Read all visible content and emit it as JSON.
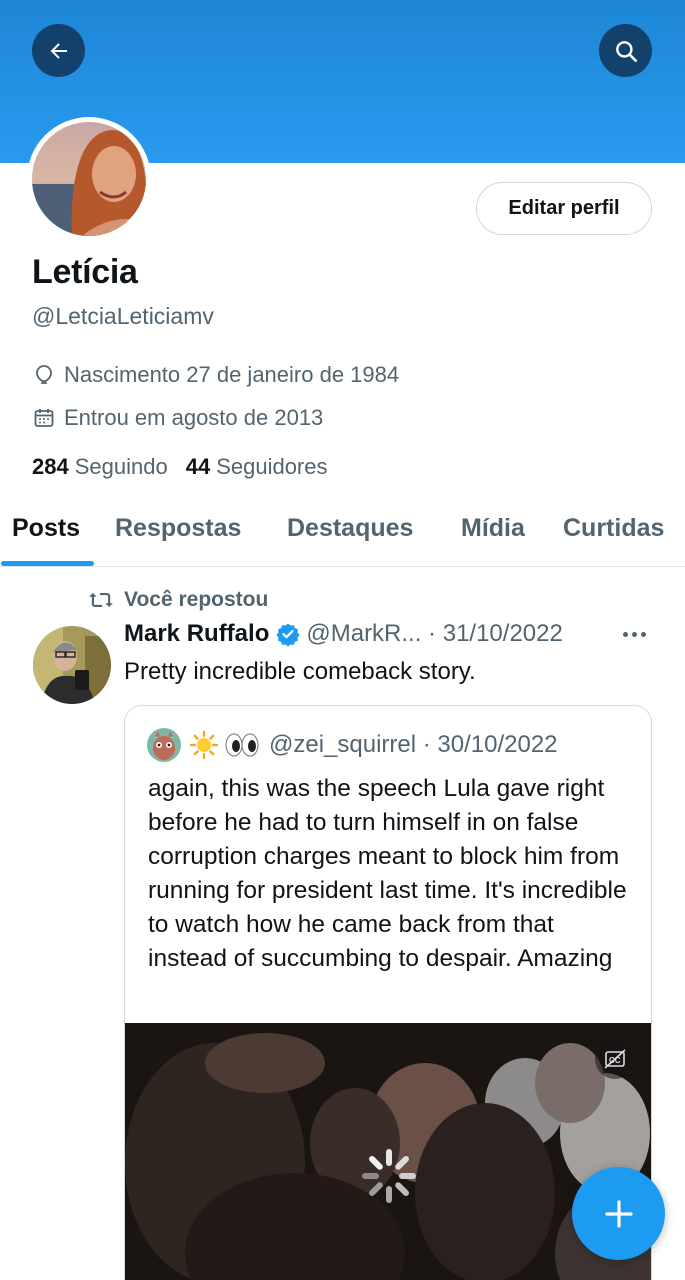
{
  "profile": {
    "name": "Letícia",
    "handle": "@LetciaLeticiamv",
    "birth": "Nascimento 27 de janeiro de 1984",
    "joined": "Entrou em agosto de 2013",
    "following_count": "284",
    "following_label": "Seguindo",
    "followers_count": "44",
    "followers_label": "Seguidores",
    "edit_label": "Editar perfil"
  },
  "tabs": [
    {
      "label": "Posts",
      "active": true
    },
    {
      "label": "Respostas",
      "active": false
    },
    {
      "label": "Destaques",
      "active": false
    },
    {
      "label": "Mídia",
      "active": false
    },
    {
      "label": "Curtidas",
      "active": false
    }
  ],
  "post": {
    "repost_label": "Você repostou",
    "author": "Mark Ruffalo",
    "handle_date": "@MarkR... · 31/10/2022",
    "text": "Pretty incredible comeback story.",
    "quote": {
      "handle_date": "@zei_squirrel · 30/10/2022",
      "text": "again, this was the speech Lula gave right before he had to turn himself in on false corruption charges meant to block him from running for president last time. It's incredible to watch how he came back from that instead of succumbing to despair. Amazing"
    }
  },
  "icons": {
    "back": "arrow-left-icon",
    "search": "search-icon",
    "birth": "balloon-icon",
    "joined": "calendar-icon",
    "repost": "repost-icon",
    "verified": "verified-badge-icon",
    "more": "more-dots-icon",
    "captions": "captions-icon",
    "loading": "loading-spinner-icon",
    "compose": "plus-icon"
  },
  "colors": {
    "accent": "#1d9bf0",
    "banner": "#2a9aef",
    "secondary_text": "#536471"
  }
}
